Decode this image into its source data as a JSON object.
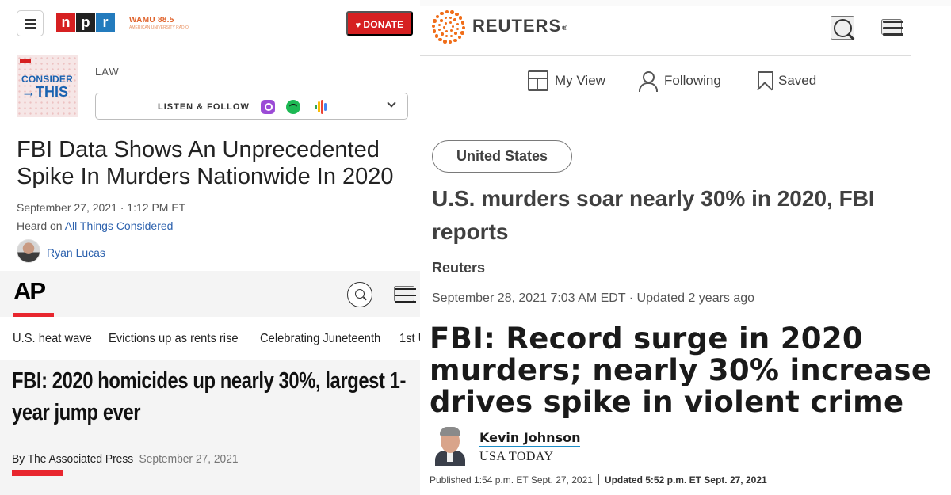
{
  "npr": {
    "logo_letters": [
      "n",
      "p",
      "r"
    ],
    "station": "WAMU 88.5",
    "station_tagline": "AMERICAN UNIVERSITY RADIO",
    "donate_label": "DONATE",
    "podcast_line1": "CONSIDER",
    "podcast_line2": "→THIS",
    "section": "LAW",
    "listen_label": "LISTEN & FOLLOW",
    "title": "FBI Data Shows An Unprecedented Spike In Murders Nationwide In 2020",
    "date": "September 27, 2021 · 1:12 PM ET",
    "heard_prefix": "Heard on ",
    "heard_show": "All Things Considered",
    "author": "Ryan Lucas",
    "colors": {
      "red": "#d62021",
      "black": "#222222",
      "blue": "#237bbd",
      "link": "#2d62ae"
    }
  },
  "ap": {
    "logo": "AP",
    "trending": [
      "U.S. heat wave",
      "Evictions up as rents rise",
      "Celebrating Juneteenth",
      "1st U"
    ],
    "title": "FBI: 2020 homicides up nearly 30%, largest 1-year jump ever",
    "byline": "By The Associated Press",
    "date": "September 27, 2021",
    "colors": {
      "accent": "#e8262e"
    }
  },
  "reuters": {
    "brand": "REUTERS",
    "brand_mark": "®",
    "nav": [
      {
        "label": "My View",
        "icon": "layout-icon"
      },
      {
        "label": "Following",
        "icon": "person-icon"
      },
      {
        "label": "Saved",
        "icon": "bookmark-icon"
      }
    ],
    "tag": "United States",
    "title": "U.S. murders soar nearly 30% in 2020, FBI reports",
    "source": "Reuters",
    "date": "September 28, 2021 7:03 AM EDT · Updated 2 years ago",
    "colors": {
      "brand_orange": "#f06d19",
      "text": "#404040"
    }
  },
  "usatoday": {
    "title": "FBI: Record surge in 2020 murders; nearly 30% increase drives spike in violent crime",
    "author": "Kevin Johnson",
    "outlet": "USA TODAY",
    "published": "Published 1:54 p.m. ET Sept. 27, 2021",
    "updated": "Updated 5:52 p.m. ET Sept. 27, 2021",
    "colors": {
      "underline": "#1b8cc7"
    }
  }
}
